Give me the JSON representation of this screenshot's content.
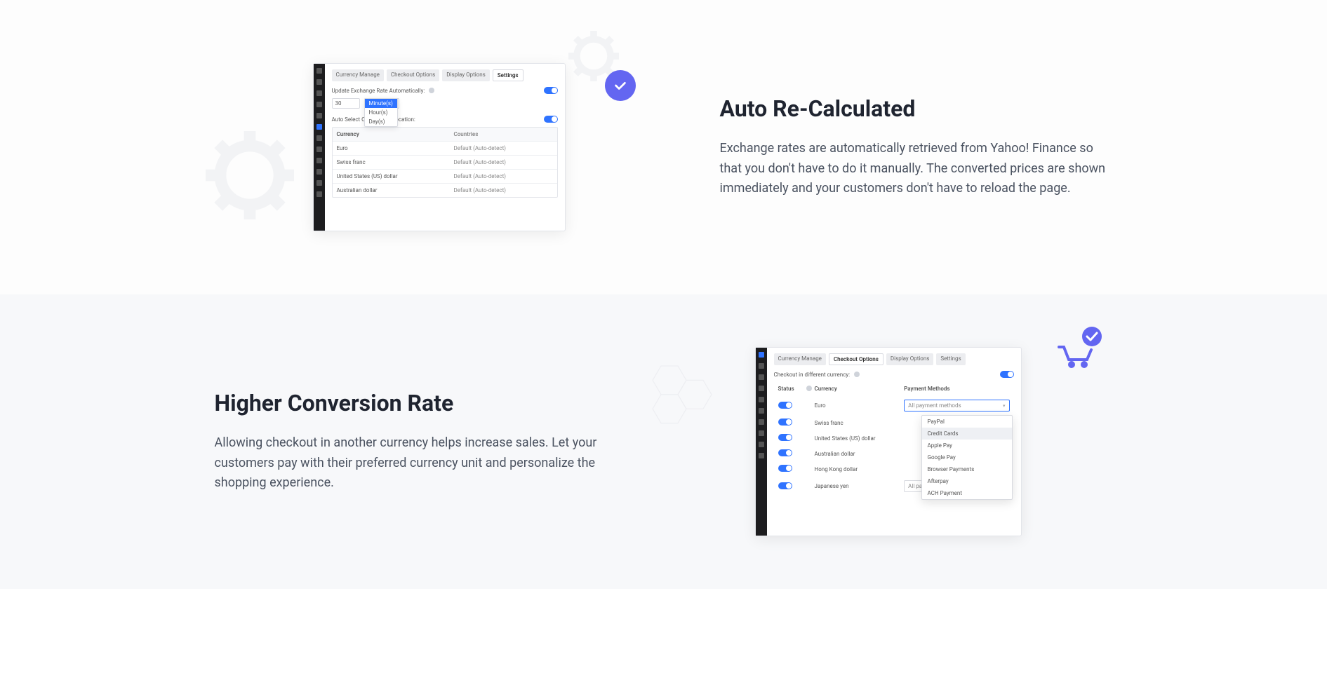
{
  "section1": {
    "heading": "Auto Re-Calculated",
    "body": "Exchange rates are automatically retrieved from Yahoo! Finance so that you don't have to do it manually. The converted prices are shown immediately and your customers don't have to reload the page."
  },
  "section2": {
    "heading": "Higher Conversion Rate",
    "body": "Allowing checkout in another currency helps increase sales. Let your customers pay with their preferred currency unit and personalize the shopping experience."
  },
  "mock1": {
    "tabs": [
      "Currency Manage",
      "Checkout Options",
      "Display Options",
      "Settings"
    ],
    "active_tab": "Settings",
    "label_update": "Update Exchange Rate Automatically:",
    "interval_value": "30",
    "unit_options": [
      "Minute(s)",
      "Hour(s)",
      "Day(s)"
    ],
    "unit_selected": "Minute(s)",
    "label_auto_select": "Auto Select Currency by Location:",
    "th_currency": "Currency",
    "th_countries": "Countries",
    "rows": [
      {
        "currency": "Euro",
        "countries": "Default (Auto-detect)"
      },
      {
        "currency": "Swiss franc",
        "countries": "Default (Auto-detect)"
      },
      {
        "currency": "United States (US) dollar",
        "countries": "Default (Auto-detect)"
      },
      {
        "currency": "Australian dollar",
        "countries": "Default (Auto-detect)"
      }
    ]
  },
  "mock2": {
    "tabs": [
      "Currency Manage",
      "Checkout Options",
      "Display Options",
      "Settings"
    ],
    "active_tab": "Checkout Options",
    "label_checkout": "Checkout in different currency:",
    "th_status": "Status",
    "th_currency": "Currency",
    "th_payment": "Payment Methods",
    "select_placeholder": "All payment methods",
    "rows": [
      {
        "currency": "Euro"
      },
      {
        "currency": "Swiss franc"
      },
      {
        "currency": "United States (US) dollar"
      },
      {
        "currency": "Australian dollar"
      },
      {
        "currency": "Hong Kong dollar"
      },
      {
        "currency": "Japanese yen"
      }
    ],
    "payment_options": [
      "PayPal",
      "Credit Cards",
      "Apple Pay",
      "Google Pay",
      "Browser Payments",
      "Afterpay",
      "ACH Payment"
    ],
    "payment_highlight": "Credit Cards"
  }
}
